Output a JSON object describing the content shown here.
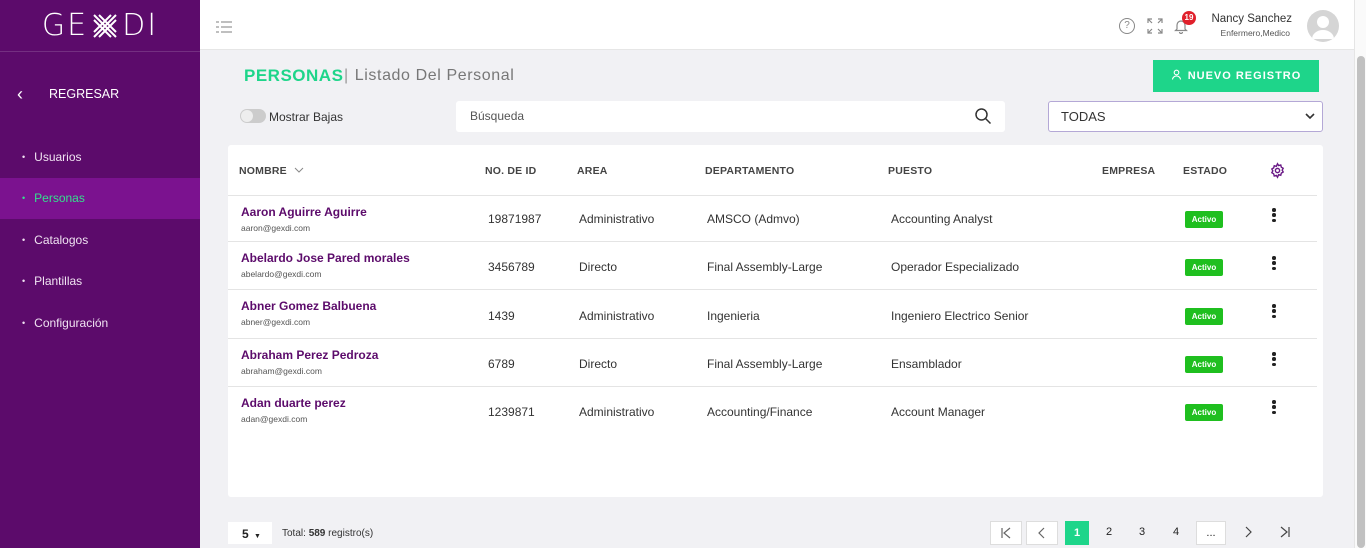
{
  "brand": {
    "logo": "GEXDI"
  },
  "sidebar": {
    "back_label": "REGRESAR",
    "items": [
      {
        "label": "Usuarios"
      },
      {
        "label": "Personas"
      },
      {
        "label": "Catalogos"
      },
      {
        "label": "Plantillas"
      },
      {
        "label": "Configuración"
      }
    ]
  },
  "topbar": {
    "notifications": "19",
    "user_name": "Nancy Sanchez",
    "user_role": "Enfermero,Medico"
  },
  "page": {
    "title": "PERSONAS",
    "subtitle": "Listado Del Personal",
    "new_button": "NUEVO REGISTRO"
  },
  "filters": {
    "toggle_label": "Mostrar Bajas",
    "search_placeholder": "Búsqueda",
    "select_value": "TODAS"
  },
  "table": {
    "headers": {
      "name": "NOMBRE",
      "id": "NO. DE ID",
      "area": "AREA",
      "department": "DEPARTAMENTO",
      "position": "PUESTO",
      "company": "EMPRESA",
      "status": "ESTADO"
    },
    "rows": [
      {
        "name": "Aaron Aguirre Aguirre",
        "email": "aaron@gexdi.com",
        "id": "19871987",
        "area": "Administrativo",
        "department": "AMSCO (Admvo)",
        "position": "Accounting Analyst",
        "company": "",
        "status": "Activo"
      },
      {
        "name": "Abelardo Jose Pared morales",
        "email": "abelardo@gexdi.com",
        "id": "3456789",
        "area": "Directo",
        "department": "Final Assembly-Large",
        "position": "Operador Especializado",
        "company": "",
        "status": "Activo"
      },
      {
        "name": "Abner Gomez Balbuena",
        "email": "abner@gexdi.com",
        "id": "1439",
        "area": "Administrativo",
        "department": "Ingenieria",
        "position": "Ingeniero Electrico Senior",
        "company": "",
        "status": "Activo"
      },
      {
        "name": "Abraham Perez Pedroza",
        "email": "abraham@gexdi.com",
        "id": "6789",
        "area": "Directo",
        "department": "Final Assembly-Large",
        "position": "Ensamblador",
        "company": "",
        "status": "Activo"
      },
      {
        "name": "Adan duarte perez",
        "email": "adan@gexdi.com",
        "id": "1239871",
        "area": "Administrativo",
        "department": "Accounting/Finance",
        "position": "Account Manager",
        "company": "",
        "status": "Activo"
      }
    ]
  },
  "footer": {
    "page_size": "5",
    "total_prefix": "Total:",
    "total_count": "589",
    "total_suffix": "registro(s)",
    "pages": [
      "1",
      "2",
      "3",
      "4",
      "..."
    ],
    "current_page": "1"
  },
  "colors": {
    "sidebar_bg": "#5c0b6b",
    "sidebar_active": "#7b128f",
    "accent_green": "#1ed58a",
    "status_green": "#1fbf1f",
    "name_purple": "#5c0b6b"
  }
}
